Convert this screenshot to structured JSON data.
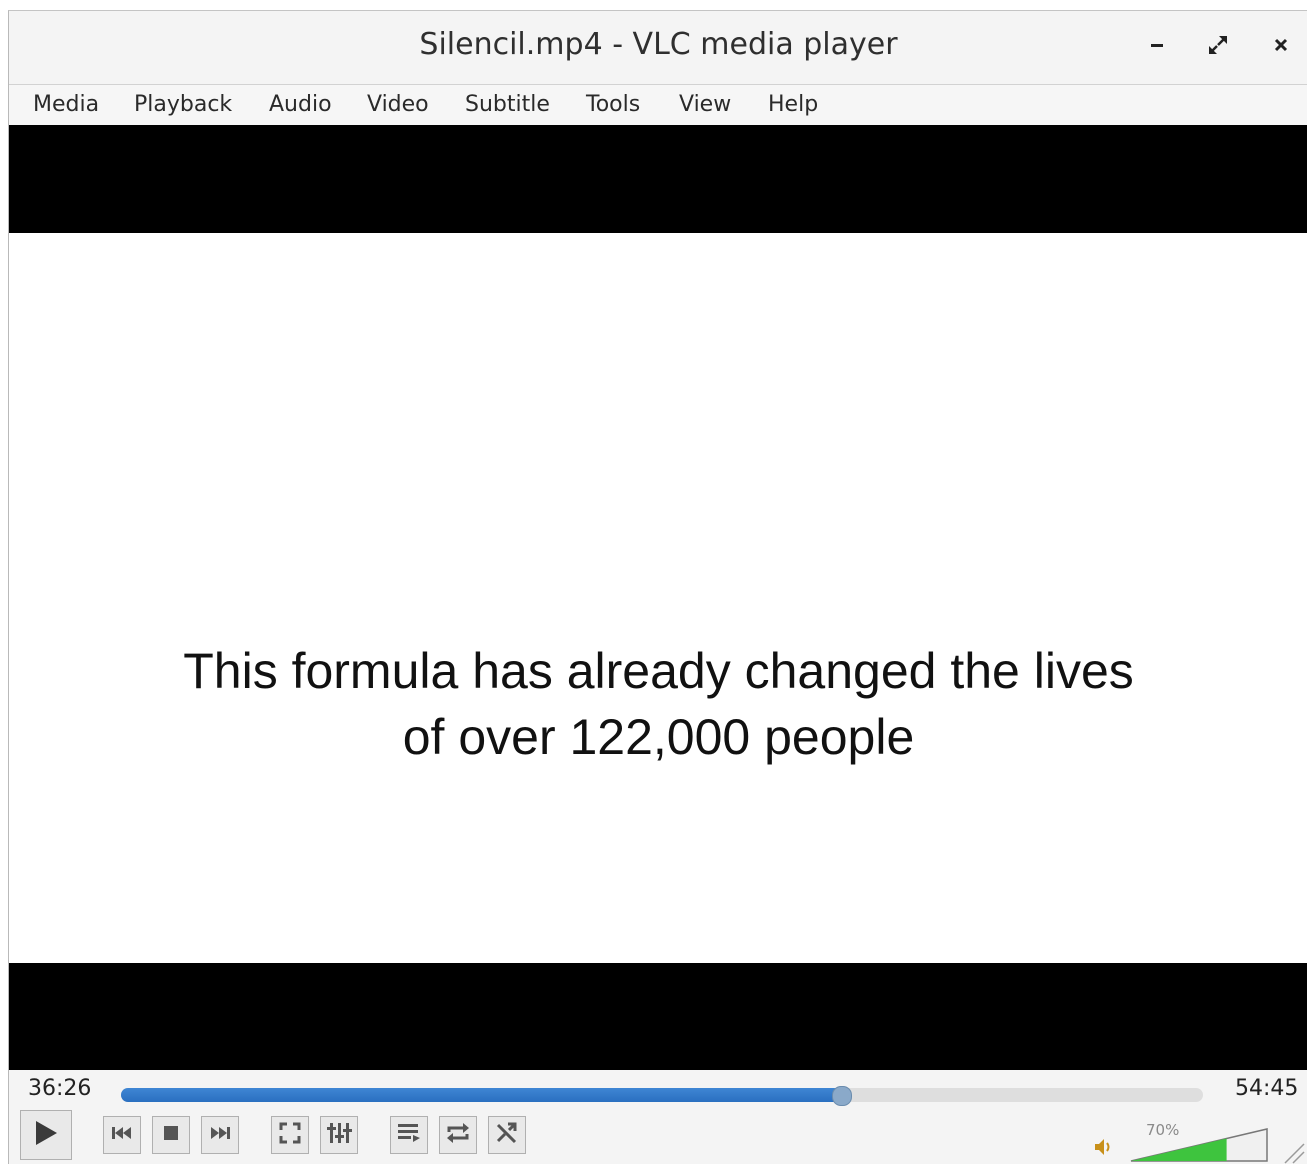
{
  "window": {
    "title": "Silencil.mp4 - VLC media player"
  },
  "menu": {
    "items": [
      "Media",
      "Playback",
      "Audio",
      "Video",
      "Subtitle",
      "Tools",
      "View",
      "Help"
    ]
  },
  "video": {
    "caption_line1": "This formula has already changed the lives",
    "caption_line2": "of over 122,000 people"
  },
  "playback": {
    "elapsed": "36:26",
    "total": "54:45",
    "progress": 0.6655
  },
  "volume": {
    "label": "70%",
    "level": 0.7
  },
  "colors": {
    "accent": "#2a6fc0",
    "volume_fill": "#3ec43e"
  },
  "icons": {
    "play": "play-icon",
    "previous": "previous-icon",
    "stop": "stop-icon",
    "next": "next-icon",
    "fullscreen": "fullscreen-icon",
    "extended_settings": "equalizer-icon",
    "playlist": "playlist-icon",
    "loop": "loop-icon",
    "shuffle": "shuffle-icon",
    "mute": "speaker-icon"
  }
}
